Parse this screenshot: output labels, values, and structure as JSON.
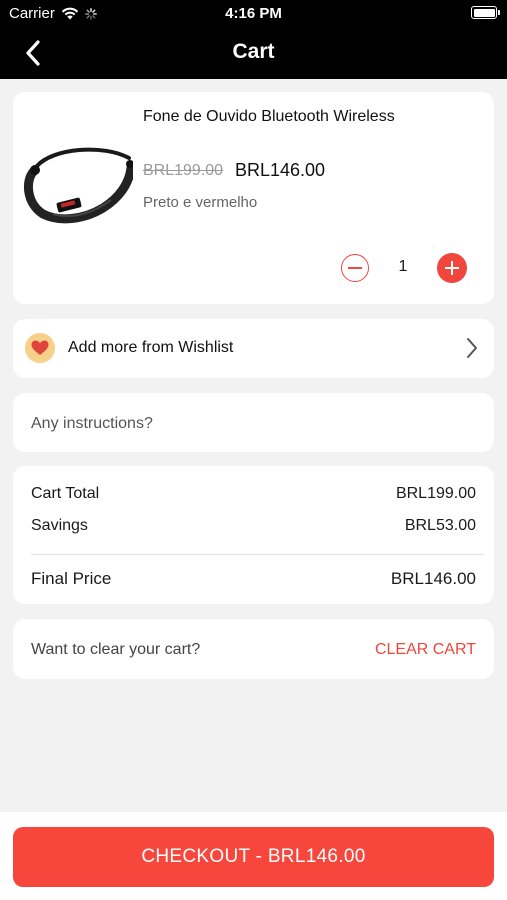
{
  "status_bar": {
    "carrier": "Carrier",
    "time": "4:16 PM"
  },
  "nav": {
    "title": "Cart"
  },
  "cart_item": {
    "name": "Fone de Ouvido Bluetooth Wireless",
    "original_price": "BRL199.00",
    "price": "BRL146.00",
    "variant": "Preto e vermelho",
    "quantity": "1"
  },
  "wishlist": {
    "label": "Add more from Wishlist"
  },
  "instructions": {
    "placeholder": "Any instructions?"
  },
  "summary": {
    "cart_total_label": "Cart Total",
    "cart_total_value": "BRL199.00",
    "savings_label": "Savings",
    "savings_value": "BRL53.00",
    "final_label": "Final Price",
    "final_value": "BRL146.00"
  },
  "clear": {
    "question": "Want to clear your cart?",
    "button": "CLEAR CART"
  },
  "checkout": {
    "label": "CHECKOUT - BRL146.00"
  },
  "colors": {
    "accent": "#f0463c",
    "header": "#000000",
    "background": "#f2f2f2"
  }
}
